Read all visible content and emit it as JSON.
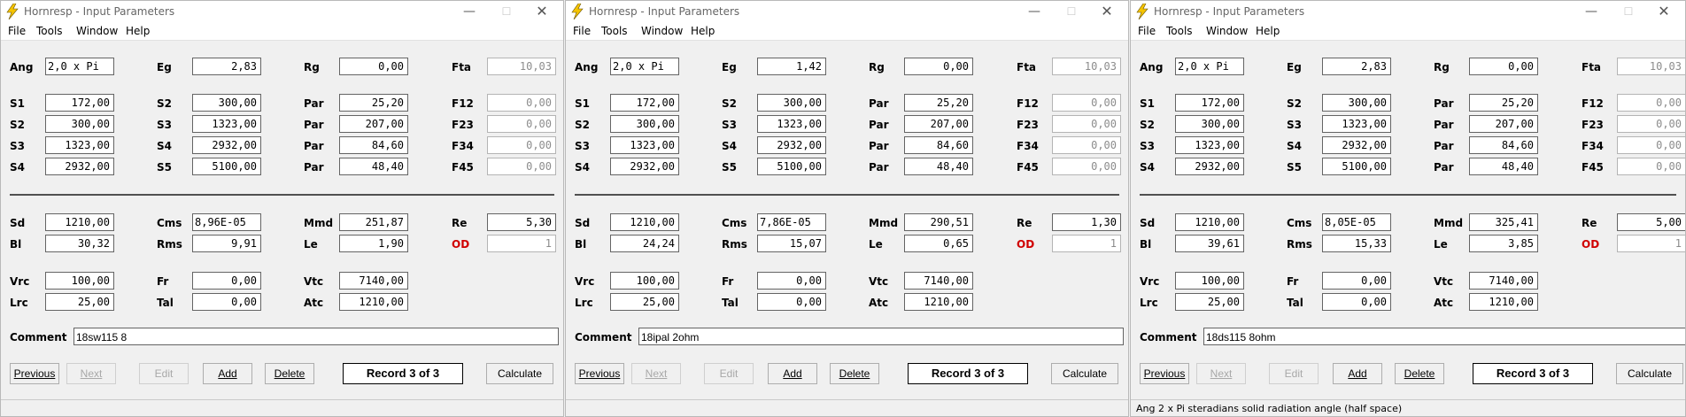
{
  "app_title": "Hornresp - Input Parameters",
  "menu": [
    "File",
    "Tools",
    "Window",
    "Help"
  ],
  "labels": {
    "ang": "Ang",
    "eg": "Eg",
    "rg": "Rg",
    "fta": "Fta",
    "s1": "S1",
    "s2": "S2",
    "s3": "S3",
    "s4": "S4",
    "s5": "S5",
    "par": "Par",
    "f12": "F12",
    "f23": "F23",
    "f34": "F34",
    "f45": "F45",
    "sd": "Sd",
    "bl": "Bl",
    "cms": "Cms",
    "rms": "Rms",
    "mmd": "Mmd",
    "le": "Le",
    "re": "Re",
    "od": "OD",
    "vrc": "Vrc",
    "lrc": "Lrc",
    "fr": "Fr",
    "tal": "Tal",
    "vtc": "Vtc",
    "atc": "Atc",
    "comment": "Comment"
  },
  "buttons": {
    "previous": "Previous",
    "next": "Next",
    "edit": "Edit",
    "add": "Add",
    "delete": "Delete",
    "calculate": "Calculate"
  },
  "windows": [
    {
      "ang": "2,0 x Pi",
      "eg": "2,83",
      "rg": "0,00",
      "fta": "10,03",
      "s1": "172,00",
      "s2a": "300,00",
      "s2b": "300,00",
      "s3a": "1323,00",
      "s3b": "1323,00",
      "s4a": "2932,00",
      "s4b": "2932,00",
      "s5": "5100,00",
      "par1": "25,20",
      "par2": "207,00",
      "par3": "84,60",
      "par4": "48,40",
      "f12": "0,00",
      "f23": "0,00",
      "f34": "0,00",
      "f45": "0,00",
      "sd": "1210,00",
      "bl": "30,32",
      "cms": "8,96E-05",
      "rms": "9,91",
      "mmd": "251,87",
      "le": "1,90",
      "re": "5,30",
      "od": "1",
      "vrc": "100,00",
      "lrc": "25,00",
      "fr": "0,00",
      "tal": "0,00",
      "vtc": "7140,00",
      "atc": "1210,00",
      "comment": "18sw115 8",
      "record": "Record 3 of 3",
      "status": ""
    },
    {
      "ang": "2,0 x Pi",
      "eg": "1,42",
      "rg": "0,00",
      "fta": "10,03",
      "s1": "172,00",
      "s2a": "300,00",
      "s2b": "300,00",
      "s3a": "1323,00",
      "s3b": "1323,00",
      "s4a": "2932,00",
      "s4b": "2932,00",
      "s5": "5100,00",
      "par1": "25,20",
      "par2": "207,00",
      "par3": "84,60",
      "par4": "48,40",
      "f12": "0,00",
      "f23": "0,00",
      "f34": "0,00",
      "f45": "0,00",
      "sd": "1210,00",
      "bl": "24,24",
      "cms": "7,86E-05",
      "rms": "15,07",
      "mmd": "290,51",
      "le": "0,65",
      "re": "1,30",
      "od": "1",
      "vrc": "100,00",
      "lrc": "25,00",
      "fr": "0,00",
      "tal": "0,00",
      "vtc": "7140,00",
      "atc": "1210,00",
      "comment": "18ipal 2ohm",
      "record": "Record 3 of 3",
      "status": ""
    },
    {
      "ang": "2,0 x Pi",
      "eg": "2,83",
      "rg": "0,00",
      "fta": "10,03",
      "s1": "172,00",
      "s2a": "300,00",
      "s2b": "300,00",
      "s3a": "1323,00",
      "s3b": "1323,00",
      "s4a": "2932,00",
      "s4b": "2932,00",
      "s5": "5100,00",
      "par1": "25,20",
      "par2": "207,00",
      "par3": "84,60",
      "par4": "48,40",
      "f12": "0,00",
      "f23": "0,00",
      "f34": "0,00",
      "f45": "0,00",
      "sd": "1210,00",
      "bl": "39,61",
      "cms": "8,05E-05",
      "rms": "15,33",
      "mmd": "325,41",
      "le": "3,85",
      "re": "5,00",
      "od": "1",
      "vrc": "100,00",
      "lrc": "25,00",
      "fr": "0,00",
      "tal": "0,00",
      "vtc": "7140,00",
      "atc": "1210,00",
      "comment": "18ds115 8ohm",
      "record": "Record 3 of 3",
      "status": "Ang   2 x Pi steradians solid radiation angle  (half space)"
    }
  ],
  "colors": {
    "icon_yellow": "#f5c400",
    "od_label": "#d00000"
  }
}
